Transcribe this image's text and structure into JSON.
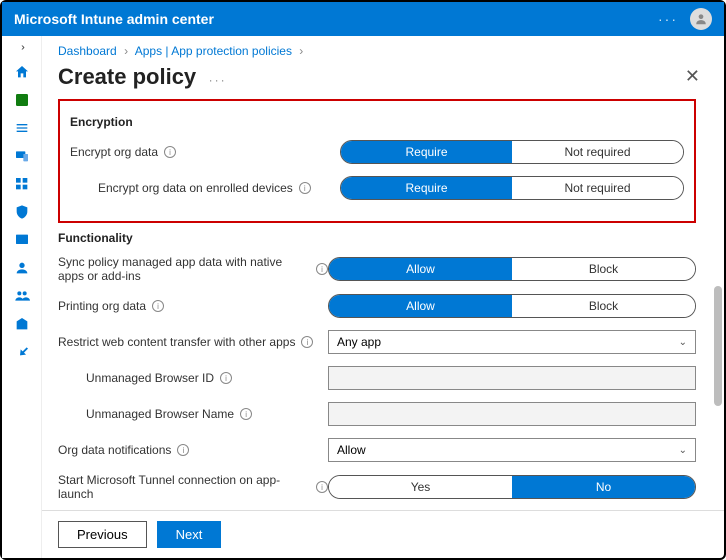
{
  "header": {
    "product": "Microsoft Intune admin center"
  },
  "breadcrumb": [
    "Dashboard",
    "Apps | App protection policies"
  ],
  "page": {
    "title": "Create policy"
  },
  "sections": {
    "encryption": {
      "heading": "Encryption",
      "rows": [
        {
          "label": "Encrypt org data",
          "opt_a": "Require",
          "opt_b": "Not required",
          "selected": "a"
        },
        {
          "label": "Encrypt org data on enrolled devices",
          "opt_a": "Require",
          "opt_b": "Not required",
          "selected": "a"
        }
      ]
    },
    "functionality": {
      "heading": "Functionality",
      "sync": {
        "label": "Sync policy managed app data with native apps or add-ins",
        "opt_a": "Allow",
        "opt_b": "Block",
        "selected": "a"
      },
      "printing": {
        "label": "Printing org data",
        "opt_a": "Allow",
        "opt_b": "Block",
        "selected": "a"
      },
      "restrict": {
        "label": "Restrict web content transfer with other apps",
        "value": "Any app"
      },
      "browser_id": {
        "label": "Unmanaged Browser ID"
      },
      "browser_name": {
        "label": "Unmanaged Browser Name"
      },
      "notifications": {
        "label": "Org data notifications",
        "value": "Allow"
      },
      "tunnel": {
        "label": "Start Microsoft Tunnel connection on app-launch",
        "opt_a": "Yes",
        "opt_b": "No",
        "selected": "b"
      }
    }
  },
  "footer": {
    "previous": "Previous",
    "next": "Next"
  }
}
